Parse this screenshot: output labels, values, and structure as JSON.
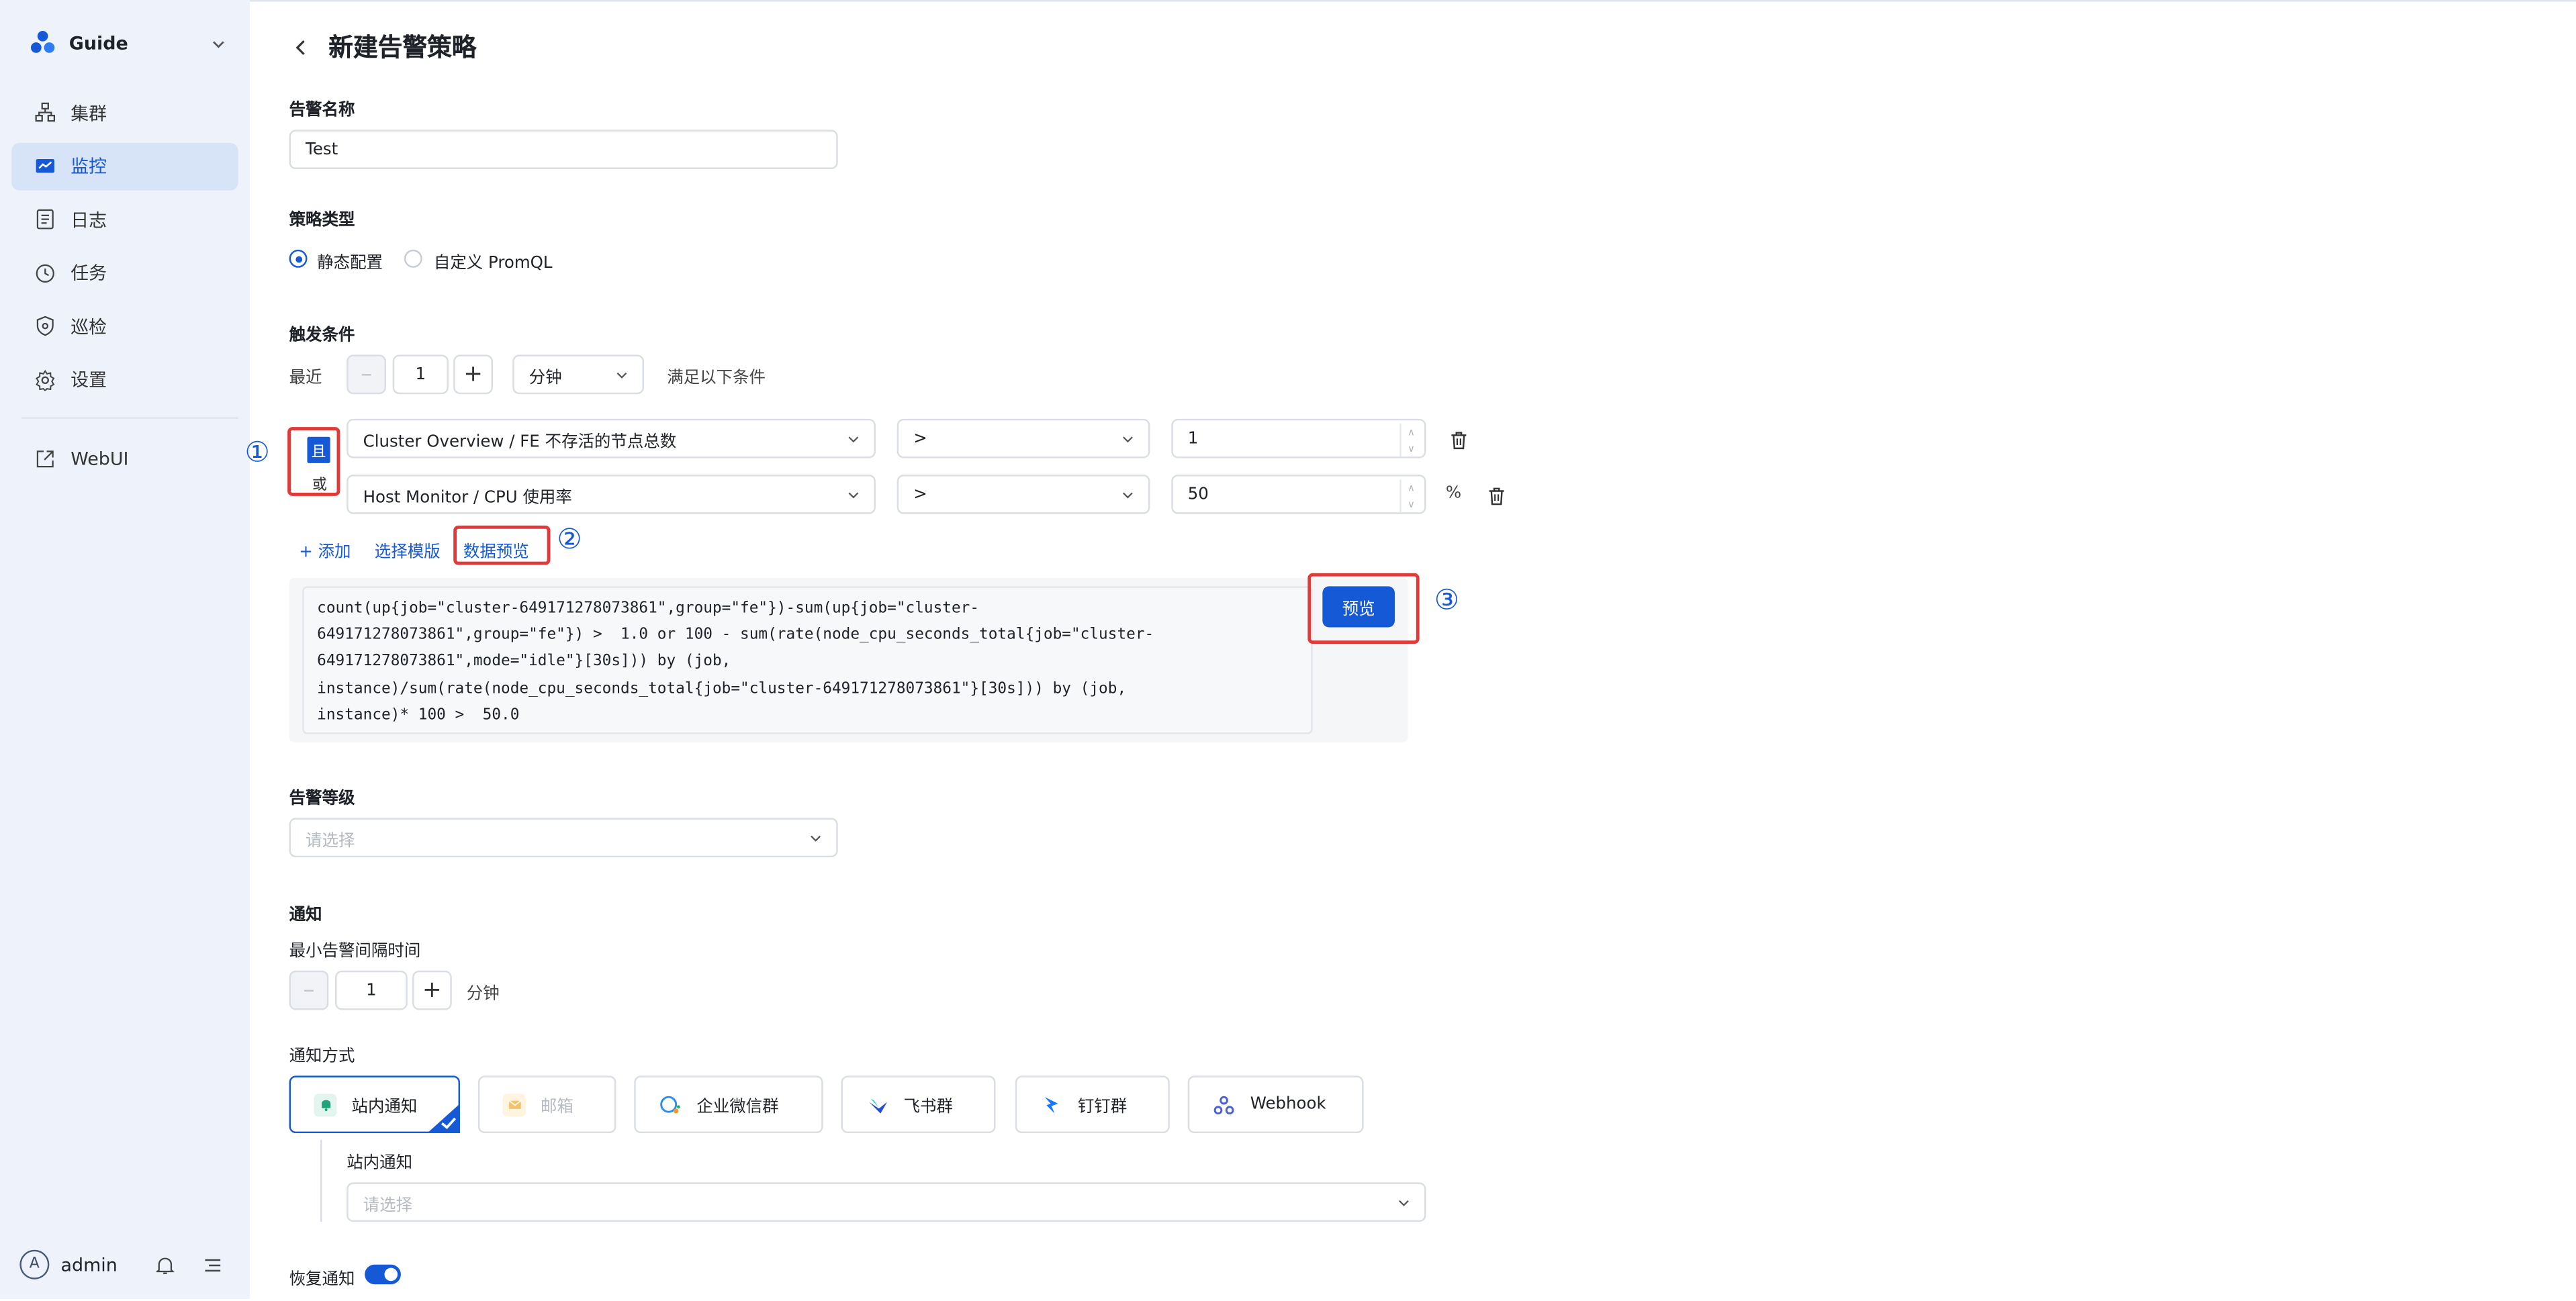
{
  "sidebar": {
    "brand": "Guide",
    "items": [
      {
        "label": "集群",
        "icon": "cluster-icon"
      },
      {
        "label": "监控",
        "icon": "monitor-icon"
      },
      {
        "label": "日志",
        "icon": "log-icon"
      },
      {
        "label": "任务",
        "icon": "task-icon"
      },
      {
        "label": "巡检",
        "icon": "shield-icon"
      },
      {
        "label": "设置",
        "icon": "gear-icon"
      }
    ],
    "webui": "WebUI",
    "user": {
      "initial": "A",
      "name": "admin"
    }
  },
  "page": {
    "title": "新建告警策略"
  },
  "form": {
    "name": {
      "label": "告警名称",
      "value": "Test"
    },
    "type": {
      "label": "策略类型",
      "options": [
        "静态配置",
        "自定义 PromQL"
      ],
      "selected": "静态配置"
    },
    "trigger": {
      "label": "触发条件",
      "recent_label": "最近",
      "recent_value": "1",
      "unit": "分钟",
      "suffix": "满足以下条件",
      "logic_and": "且",
      "logic_or": "或",
      "conditions": [
        {
          "metric": "Cluster Overview / FE 不存活的节点总数",
          "op": ">",
          "value": "1",
          "unit": ""
        },
        {
          "metric": "Host Monitor / CPU 使用率",
          "op": ">",
          "value": "50",
          "unit": "%"
        }
      ],
      "actions": {
        "add": "添加",
        "template": "选择模版",
        "preview_data": "数据预览"
      },
      "preview_button": "预览",
      "markers": [
        "①",
        "②",
        "③"
      ]
    },
    "level": {
      "label": "告警等级",
      "placeholder": "请选择"
    },
    "notify": {
      "label": "通知",
      "min_interval_label": "最小告警间隔时间",
      "min_interval_value": "1",
      "min_interval_unit": "分钟",
      "methods_label": "通知方式",
      "methods": [
        "站内通知",
        "邮箱",
        "企业微信群",
        "飞书群",
        "钉钉群",
        "Webhook"
      ],
      "selected_method": "站内通知",
      "inbox_label": "站内通知",
      "inbox_placeholder": "请选择",
      "recovery_label": "恢复通知",
      "recovery_enabled": true
    }
  },
  "code": {
    "lines": [
      "count(up{job=\"cluster-649171278073861\",group=\"fe\"})-sum(up{job=\"cluster-",
      "649171278073861\",group=\"fe\"}) >  1.0 or 100 - sum(rate(node_cpu_seconds_total{job=\"cluster-",
      "649171278073861\",mode=\"idle\"}[30s])) by (job,",
      "instance)/sum(rate(node_cpu_seconds_total{job=\"cluster-649171278073861\"}[30s])) by (job,",
      "instance)* 100 >  50.0"
    ]
  },
  "colors": {
    "accent": "#1659d6",
    "highlight": "#e03a3a",
    "sidebar_bg": "#eef3fb"
  }
}
